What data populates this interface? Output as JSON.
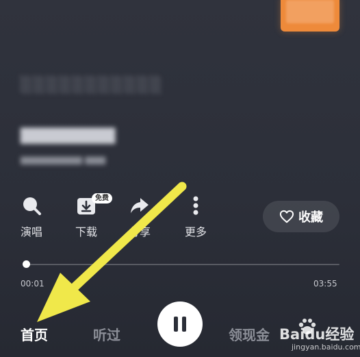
{
  "actions": {
    "sing": {
      "label": "演唱",
      "icon": "sing-icon"
    },
    "download": {
      "label": "下载",
      "icon": "download-icon",
      "badge": "免费"
    },
    "share": {
      "label": "分享",
      "icon": "share-icon"
    },
    "more": {
      "label": "更多",
      "icon": "more-icon"
    }
  },
  "collect": {
    "label": "收藏",
    "icon": "heart-outline-icon"
  },
  "player": {
    "current_time": "00:01",
    "total_time": "03:55",
    "progress": 0.005,
    "state": "playing",
    "control_icon": "pause-icon"
  },
  "tabs": [
    {
      "label": "首页",
      "active": true
    },
    {
      "label": "听过",
      "active": false
    },
    {
      "label": "领现金",
      "active": false
    }
  ],
  "watermark": {
    "text": "Baidu经验",
    "url": "jingyan.baidu.com"
  },
  "colors": {
    "background": "#2b2e38",
    "accent_cover": "#ee8a3a",
    "annotation_arrow": "#f0e84a",
    "text_primary": "#ffffff",
    "text_muted": "#8c8f98"
  }
}
